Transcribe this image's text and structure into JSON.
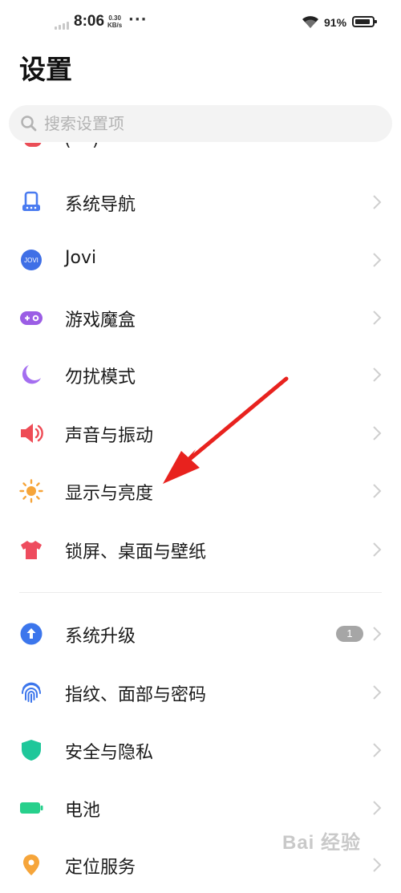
{
  "status_bar": {
    "time": "8:06",
    "speed_top": "0.30",
    "speed_unit": "KB/s",
    "more": "···",
    "battery": "91%",
    "battery_level": 0.91
  },
  "page": {
    "title": "设置"
  },
  "search": {
    "placeholder": "搜索设置项"
  },
  "clipped_item": {
    "label": "(      )"
  },
  "items": [
    {
      "label": "系统导航",
      "icon": "navigation-icon",
      "color": "#4a7bf0"
    },
    {
      "label": "Jovi",
      "icon": "jovi-icon",
      "color": "#3f6fe6"
    },
    {
      "label": "游戏魔盒",
      "icon": "game-box-icon",
      "color": "#9b5de5"
    },
    {
      "label": "勿扰模式",
      "icon": "moon-icon",
      "color": "#a46ef0"
    },
    {
      "label": "声音与振动",
      "icon": "speaker-icon",
      "color": "#ee4c56"
    },
    {
      "label": "显示与亮度",
      "icon": "sun-icon",
      "color": "#f6a53a"
    },
    {
      "label": "锁屏、桌面与壁纸",
      "icon": "tshirt-icon",
      "color": "#ee4c5e"
    },
    {
      "label": "系统升级",
      "icon": "upgrade-icon",
      "color": "#3c76ec",
      "badge": "1"
    },
    {
      "label": "指纹、面部与密码",
      "icon": "fingerprint-icon",
      "color": "#3c76ec"
    },
    {
      "label": "安全与隐私",
      "icon": "shield-icon",
      "color": "#1fc79a"
    },
    {
      "label": "电池",
      "icon": "battery-icon",
      "color": "#27d08c"
    },
    {
      "label": "定位服务",
      "icon": "location-icon",
      "color": "#f6a53a"
    }
  ],
  "watermark": "Bai 经验"
}
